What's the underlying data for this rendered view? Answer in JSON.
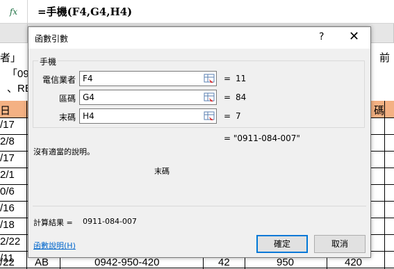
{
  "formula_bar": {
    "fx": "fx",
    "formula": "=手機(F4,G4,H4)"
  },
  "sheet": {
    "bg_text": [
      {
        "text": "者」"
      },
      {
        "text": "「09"
      },
      {
        "text": "、RE"
      },
      {
        "text": "前"
      }
    ],
    "date_col": [
      "日",
      "/17",
      "2/8",
      "/17",
      "2/1",
      "0/6",
      "/16",
      "/18",
      "2/22",
      "/11",
      "/22"
    ],
    "right_col": [
      "碼"
    ],
    "last_row": [
      "AB",
      "0942-950-420",
      "42",
      "950",
      "420"
    ]
  },
  "dialog": {
    "title": "函數引數",
    "help": "?",
    "close": "✕",
    "group_label": "手機",
    "args": [
      {
        "label": "電信業者",
        "value": "F4",
        "result": "11"
      },
      {
        "label": "區碼",
        "value": "G4",
        "result": "84"
      },
      {
        "label": "末碼",
        "value": "H4",
        "result": "7"
      }
    ],
    "eq": "=",
    "total_result": "= \"0911-084-007\"",
    "description": "沒有適當的說明。",
    "arg_desc": "末碼",
    "calc_label": "計算結果 =",
    "calc_value": "0911-084-007",
    "help_link": "函數說明(H)",
    "ok": "確定",
    "cancel": "取消"
  }
}
